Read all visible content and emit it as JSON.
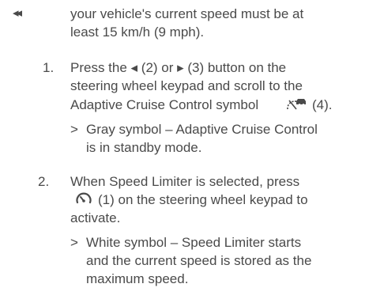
{
  "nav": {
    "continued_icon": "double-left-chevron-icon"
  },
  "intro": {
    "line1": "your vehicle's current speed must be at",
    "line2": "least 15 km/h (9 mph)."
  },
  "steps": [
    {
      "number": "1.",
      "line1": "Press the ◂ (2) or ▸ (3) button on the",
      "line2": "steering wheel keypad and scroll to the",
      "line3_before_icon": "Adaptive Cruise Control symbol",
      "line3_icon": "adaptive-cruise-control-icon",
      "line3_after_icon": "(4).",
      "result": {
        "marker": ">",
        "line1": "Gray symbol – Adaptive Cruise Control",
        "line2": "is in standby mode."
      }
    },
    {
      "number": "2.",
      "line1": "When Speed Limiter is selected, press",
      "line2_icon": "speed-limiter-icon",
      "line2_after_icon": "(1) on the steering wheel keypad to",
      "line3": "activate.",
      "result": {
        "marker": ">",
        "line1": "White symbol – Speed Limiter starts",
        "line2": "and the current speed is stored as the",
        "line3": "maximum speed."
      }
    }
  ]
}
